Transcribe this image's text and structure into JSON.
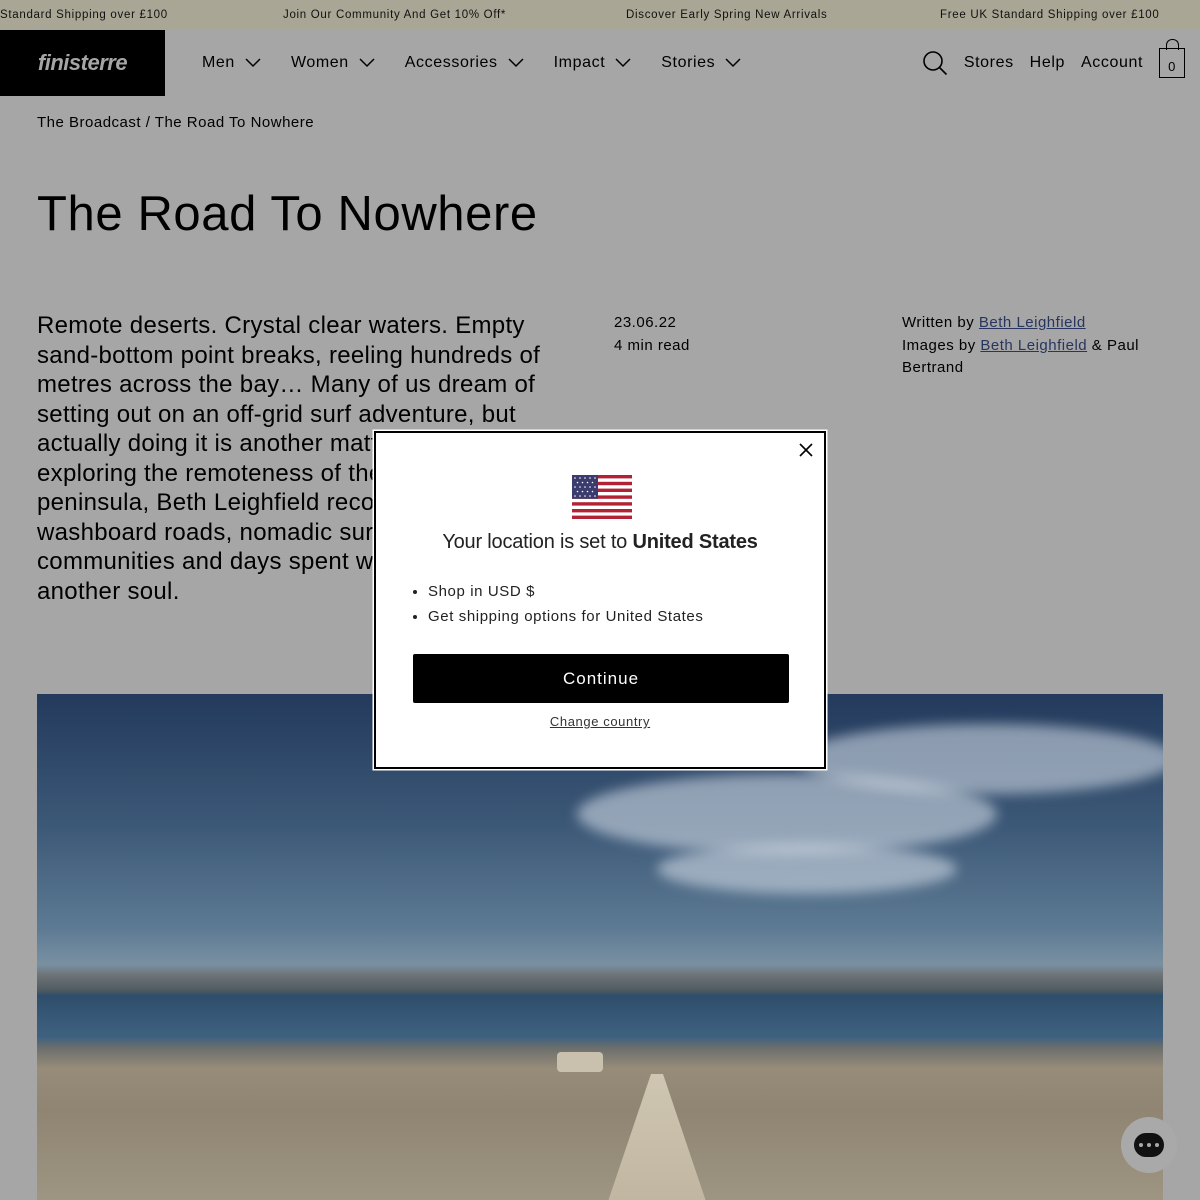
{
  "announcements": [
    "Standard Shipping over £100",
    "Join Our Community And Get 10% Off*",
    "Discover Early Spring New Arrivals",
    "Free UK Standard Shipping over £100"
  ],
  "header": {
    "logo": "finisterre",
    "nav": [
      "Men",
      "Women",
      "Accessories",
      "Impact",
      "Stories"
    ],
    "utility": {
      "stores": "Stores",
      "help": "Help",
      "account": "Account",
      "cart_count": "0"
    }
  },
  "article": {
    "breadcrumb": "The Broadcast / The Road To Nowhere",
    "title": "The Road To Nowhere",
    "intro": "Remote deserts. Crystal clear waters. Empty sand-bottom point breaks, reeling hundreds of metres across the bay… Many of us dream of setting out on an off-grid surf adventure, but actually doing it is another matter. Fresh from exploring the remoteness of the Baja peninsula, Beth Leighfield recounts a tale of washboard roads, nomadic surfing communities and days spent without seeing another soul.",
    "date": "23.06.22",
    "read_time": "4 min read",
    "written_by_label": "Written by",
    "written_by": "Beth Leighfield",
    "images_by_label": "Images by",
    "images_by_1": "Beth Leighfield",
    "images_by_join": "&",
    "images_by_2": "Paul Bertrand"
  },
  "modal": {
    "location_prefix": "Your location is set to",
    "country": "United States",
    "options": [
      "Shop in USD $",
      "Get shipping options for United States"
    ],
    "continue_label": "Continue",
    "change_label": "Change country"
  },
  "icons": {
    "search": "search-icon",
    "chevron": "chevron-down-icon",
    "cart": "bag-icon",
    "close": "close-icon",
    "flag": "us-flag-icon",
    "chat": "chat-icon"
  }
}
